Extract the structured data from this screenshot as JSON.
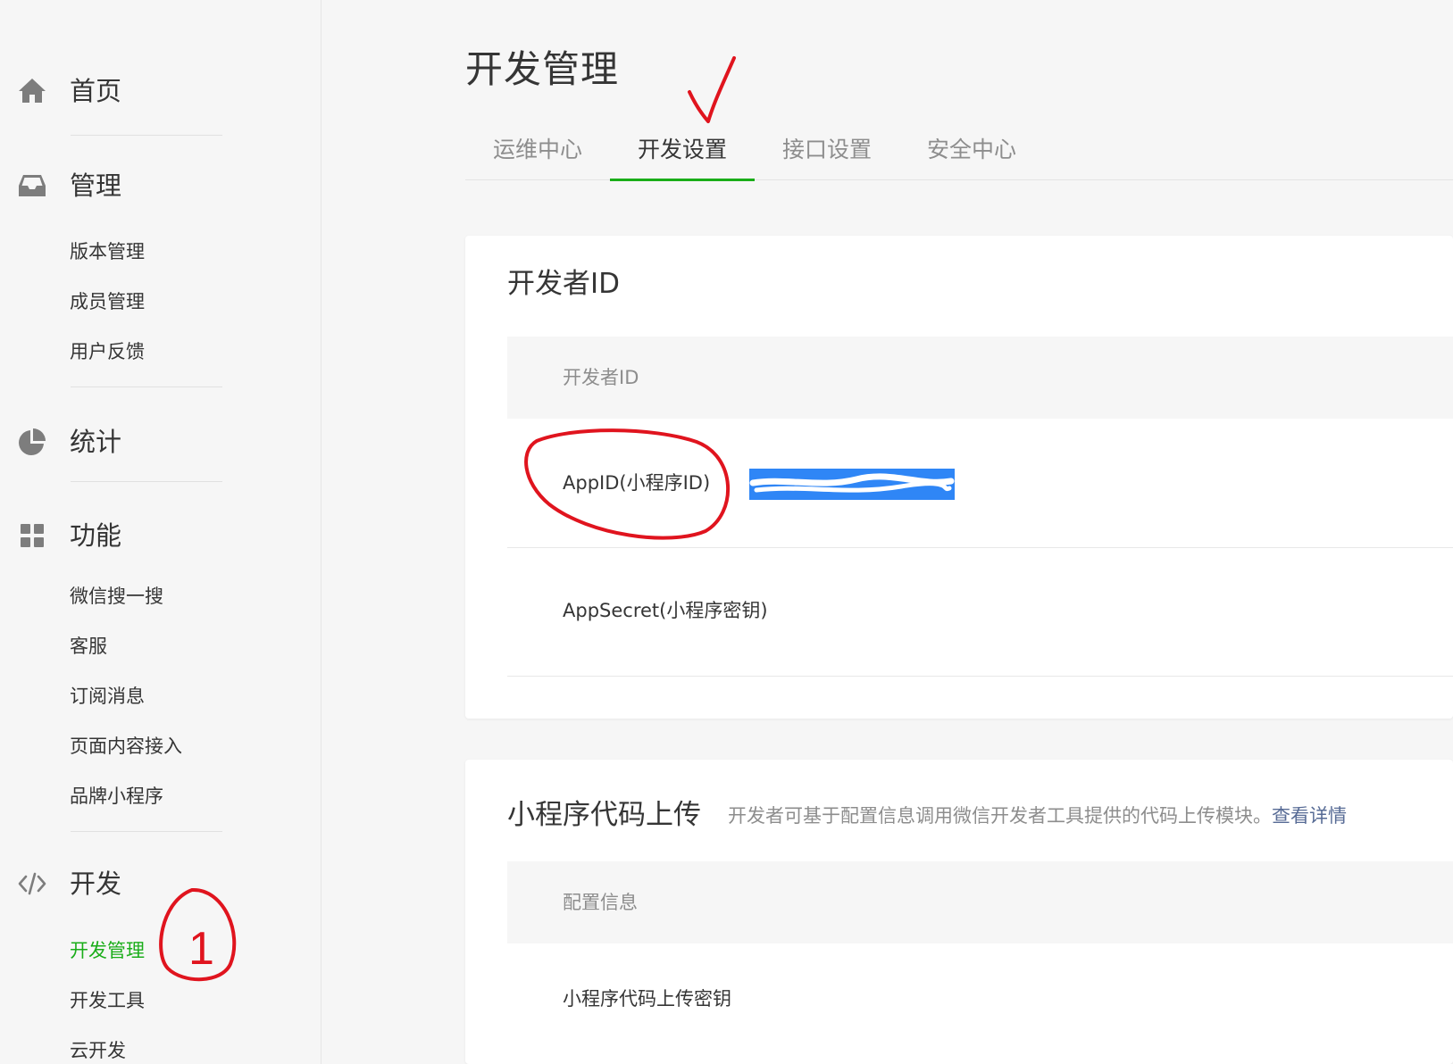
{
  "sidebar": {
    "groups": {
      "home": {
        "label": "首页",
        "icon": "home-icon"
      },
      "manage": {
        "label": "管理",
        "icon": "inbox-icon",
        "items": [
          "版本管理",
          "成员管理",
          "用户反馈"
        ]
      },
      "stats": {
        "label": "统计",
        "icon": "pie-chart-icon"
      },
      "features": {
        "label": "功能",
        "icon": "grid-icon",
        "items": [
          "微信搜一搜",
          "客服",
          "订阅消息",
          "页面内容接入",
          "品牌小程序"
        ]
      },
      "dev": {
        "label": "开发",
        "icon": "code-icon",
        "items": [
          "开发管理",
          "开发工具",
          "云开发"
        ],
        "active_item": "开发管理"
      }
    }
  },
  "page": {
    "title": "开发管理",
    "tabs": [
      "运维中心",
      "开发设置",
      "接口设置",
      "安全中心"
    ],
    "active_tab": "开发设置"
  },
  "developer_id_card": {
    "title": "开发者ID",
    "table_header": "开发者ID",
    "rows": [
      {
        "label": "AppID(小程序ID)",
        "value_redacted": true
      },
      {
        "label": "AppSecret(小程序密钥)"
      }
    ]
  },
  "upload_card": {
    "title": "小程序代码上传",
    "description": "开发者可基于配置信息调用微信开发者工具提供的代码上传模块。",
    "link": "查看详情",
    "table_header": "配置信息",
    "rows": [
      {
        "label": "小程序代码上传密钥"
      }
    ]
  },
  "annotations": {
    "circled_number": "1",
    "color": "#e0141e"
  },
  "colors": {
    "accent_green": "#1aad19",
    "link_blue": "#576b95",
    "redaction_blue": "#2f86f6"
  }
}
